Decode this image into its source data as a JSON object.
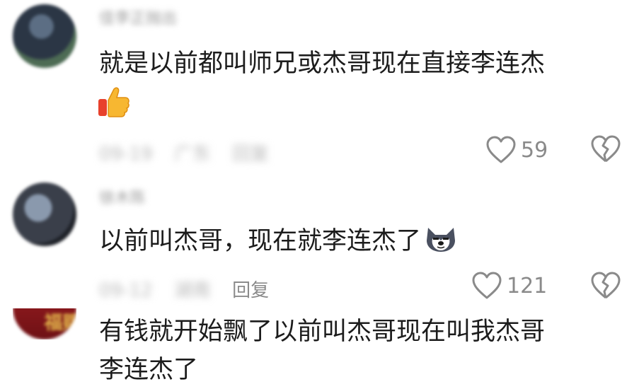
{
  "comments": [
    {
      "username": "佳李正抛出",
      "text": "就是以前都叫师兄或杰哥现在直接李连杰",
      "meta": [
        "09-19",
        "广东"
      ],
      "reply_label": "回复",
      "likes": "59"
    },
    {
      "username": "徐木陈",
      "text": "以前叫杰哥，现在就李连杰了",
      "meta": [
        "09-12",
        "湖南"
      ],
      "reply_label": "回复",
      "likes": "121"
    },
    {
      "avatar_text": "赐福",
      "text_line1": "有钱就开始飘了以前叫杰哥现在叫我杰哥",
      "text_line2": "李连杰了"
    }
  ],
  "icons": {
    "like": "heart-outline-icon",
    "dislike": "broken-heart-icon",
    "thumbs_up": "thumbs-up-emoji",
    "husky": "husky-dog-emoji"
  },
  "colors": {
    "text": "#1c1c1c",
    "muted": "#8a8a8a",
    "avatar_red": "#a01e22"
  }
}
